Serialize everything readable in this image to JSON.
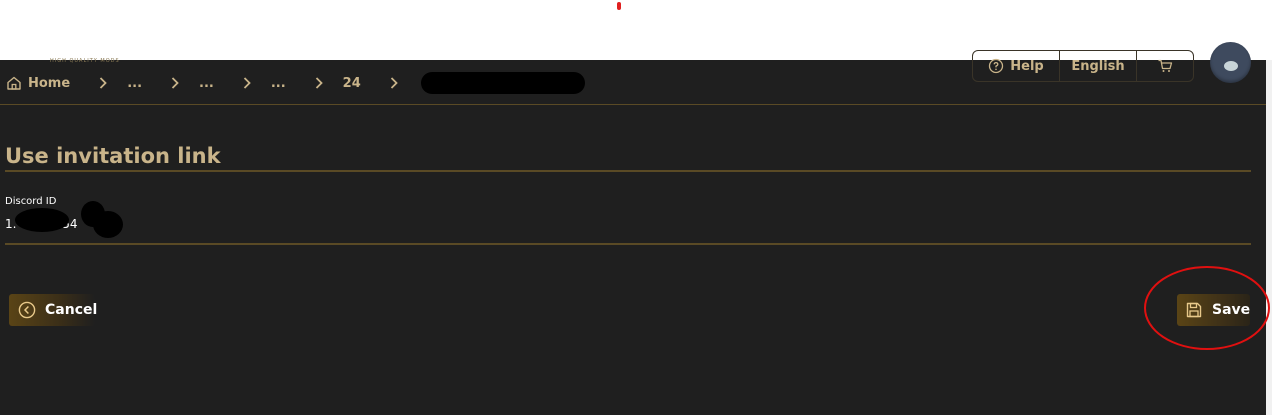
{
  "header": {
    "logo_tagline": "HIGH QUALITY MODS",
    "help_label": "Help",
    "language_label": "English"
  },
  "breadcrumb": {
    "items": [
      "Home",
      "...",
      "...",
      "...",
      "24"
    ]
  },
  "page": {
    "title": "Use invitation link"
  },
  "form": {
    "discord_label": "Discord ID",
    "discord_value": "1.          192        0854"
  },
  "actions": {
    "cancel_label": "Cancel",
    "save_label": "Save"
  },
  "colors": {
    "accent": "#c9b48a",
    "background": "#1f1f1f",
    "divider": "#5a4a25",
    "annotation": "#e01010"
  },
  "icons": {
    "home": "home-icon",
    "separator": "chevron-right-icon",
    "help": "help-circle-icon",
    "cart": "cart-icon",
    "cancel": "chevron-left-circle-icon",
    "save": "floppy-disk-icon"
  }
}
